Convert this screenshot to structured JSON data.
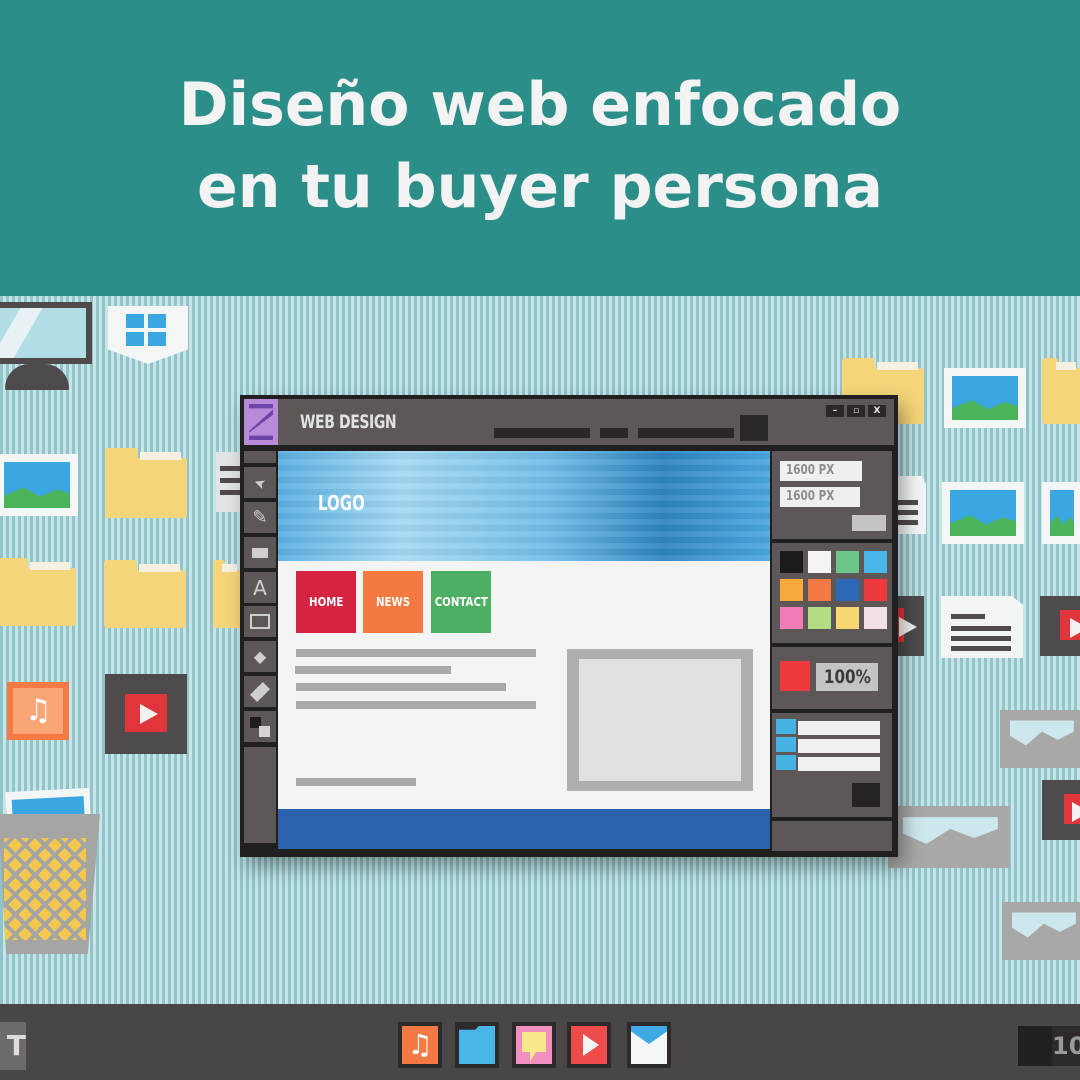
{
  "header": {
    "title_line1": "Diseño web enfocado",
    "title_line2": "en tu buyer persona",
    "background": "#2c8e88"
  },
  "window": {
    "title": "WEB DESIGN",
    "controls": {
      "minimize": "–",
      "maximize": "▫",
      "close": "X"
    },
    "tools": [
      "arrow-tool",
      "brush-tool",
      "rectangle-fill-tool",
      "text-tool",
      "rectangle-outline-tool",
      "fill-tool",
      "eraser-tool",
      "color-swap-tool"
    ],
    "tool_glyphs": [
      "➤",
      "✎",
      "▬",
      "A",
      "▭",
      "◆",
      "⌫",
      "◩"
    ],
    "canvas": {
      "logo": "LOGO",
      "nav": [
        {
          "label": "HOME",
          "color": "#d6233f"
        },
        {
          "label": "NEWS",
          "color": "#f57a42"
        },
        {
          "label": "CONTACT",
          "color": "#4caf64"
        }
      ],
      "footer_color": "#2a63ad"
    },
    "properties": {
      "width": "1600 PX",
      "height": "1600 PX"
    },
    "palette": [
      "#1d1b1c",
      "#f4f4f4",
      "#6cc68a",
      "#4ab6e8",
      "#f8a93c",
      "#f47a45",
      "#2e69b8",
      "#ee3a3d",
      "#f07bb6",
      "#b3dd83",
      "#f9d874",
      "#f2e0e6"
    ],
    "zoom": {
      "color": "#ee3a3d",
      "value": "100%"
    },
    "layers": 3
  },
  "taskbar": {
    "start_label": "T",
    "apps": [
      {
        "name": "music",
        "color": "#f47a45"
      },
      {
        "name": "folder",
        "color": "#4ab6e8"
      },
      {
        "name": "chat",
        "color": "#f28fc0"
      },
      {
        "name": "video",
        "color": "#ee4c4a"
      },
      {
        "name": "mail",
        "color": "#3ea9e2"
      }
    ],
    "clock_label": "10"
  }
}
